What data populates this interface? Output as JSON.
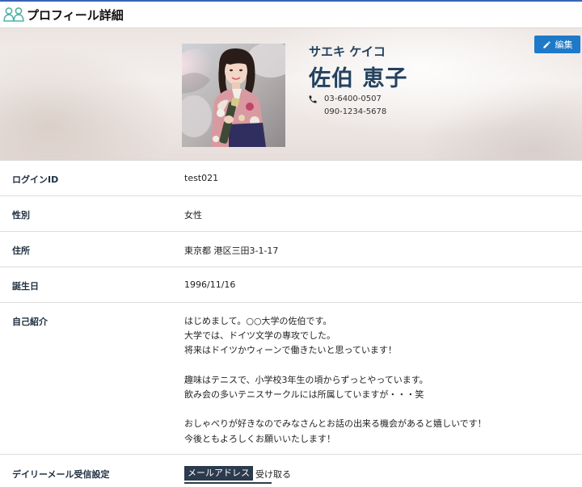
{
  "header": {
    "title": "プロフィール詳細",
    "icon": "users-icon",
    "accent": "#3a63b5"
  },
  "profile": {
    "kana": "サエキ ケイコ",
    "name": "佐伯 恵子",
    "phones": [
      "03-6400-0507",
      "090-1234-5678"
    ],
    "edit_label": "編集",
    "edit_color": "#1e79c8"
  },
  "fields": {
    "login": {
      "label": "ログインID",
      "value": "test021"
    },
    "gender": {
      "label": "性別",
      "value": "女性"
    },
    "address": {
      "label": "住所",
      "value": "東京都 港区三田3-1-17"
    },
    "birthday": {
      "label": "誕生日",
      "value": "1996/11/16"
    },
    "intro": {
      "label": "自己紹介",
      "lines": [
        "はじめまして。○○大学の佐伯です。",
        "大学では、ドイツ文学の専攻でした。",
        "将来はドイツかウィーンで働きたいと思っています！",
        "",
        "趣味はテニスで、小学校3年生の頃からずっとやっています。",
        "飲み会の多いテニスサークルには所属していますが・・・笑",
        "",
        "おしゃべりが好きなのでみなさんとお話の出来る機会があると嬉しいです！",
        "今後ともよろしくお願いいたします！"
      ]
    },
    "mail": {
      "label": "デイリーメール受信設定",
      "tag": "メールアドレス",
      "value": "受け取る"
    }
  }
}
